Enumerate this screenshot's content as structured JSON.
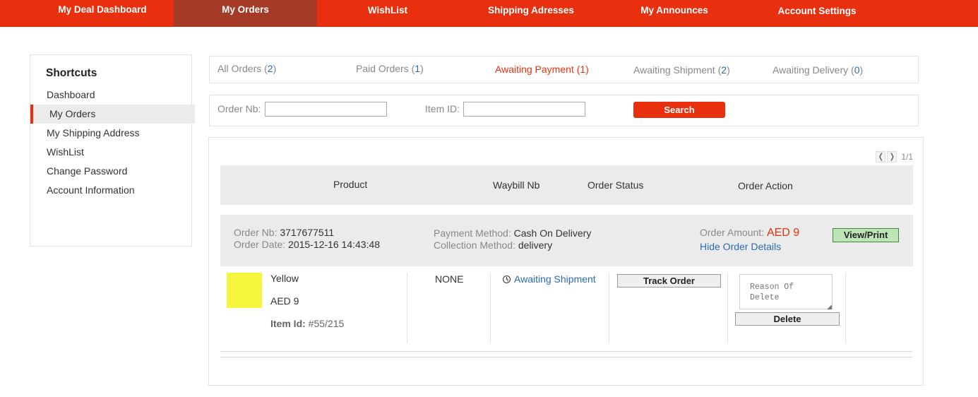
{
  "topnav": {
    "items": [
      {
        "label": "My Deal Dashboard"
      },
      {
        "label": "My Orders"
      },
      {
        "label": "WishList"
      },
      {
        "label": "Shipping Adresses"
      },
      {
        "label": "My Announces"
      },
      {
        "label": "Account Settings"
      }
    ],
    "active_index": 1,
    "colors": {
      "bar": "#e8300f",
      "active": "#a53a26"
    }
  },
  "sidebar": {
    "title": "Shortcuts",
    "items": [
      {
        "label": "Dashboard"
      },
      {
        "label": "My Orders"
      },
      {
        "label": "My Shipping Address"
      },
      {
        "label": "WishList"
      },
      {
        "label": "Change Password"
      },
      {
        "label": "Account Information"
      }
    ],
    "active_index": 1
  },
  "tabs": [
    {
      "label": "All Orders",
      "count": "2"
    },
    {
      "label": "Paid Orders",
      "count": "1"
    },
    {
      "label": "Awaiting Payment",
      "count": "1"
    },
    {
      "label": "Awaiting Shipment",
      "count": "2"
    },
    {
      "label": "Awaiting Delivery",
      "count": "0"
    }
  ],
  "active_tab_index": 2,
  "search": {
    "order_nb_label": "Order Nb:",
    "order_nb_value": "",
    "item_id_label": "Item ID:",
    "item_id_value": "",
    "button_label": "Search"
  },
  "pager": {
    "prev_icon": "chevron-left-icon",
    "next_icon": "chevron-right-icon",
    "prev_glyph": "❬",
    "next_glyph": "❭",
    "info": "1/1"
  },
  "table": {
    "headers": [
      "Product",
      "Waybill Nb",
      "Order Status",
      "Order Action"
    ]
  },
  "order": {
    "order_nb_label": "Order Nb:",
    "order_nb": "3717677511",
    "order_date_label": "Order Date:",
    "order_date": "2015-12-16 14:43:48",
    "payment_method_label": "Payment Method:",
    "payment_method": "Cash On Delivery",
    "collection_method_label": "Collection Method:",
    "collection_method": "delivery",
    "amount_label": "Order Amount:",
    "amount": "AED 9",
    "hide_details": "Hide Order Details",
    "view_print": "View/Print",
    "item": {
      "color_name": "Yellow",
      "thumb_color": "#f5f53d",
      "price": "AED 9",
      "item_id_label": "Item Id:",
      "item_id": "#55/215",
      "waybill": "NONE",
      "status": "Awaiting Shipment",
      "track_button": "Track Order",
      "reason_placeholder": "Reason Of Delete",
      "delete_button": "Delete"
    }
  }
}
